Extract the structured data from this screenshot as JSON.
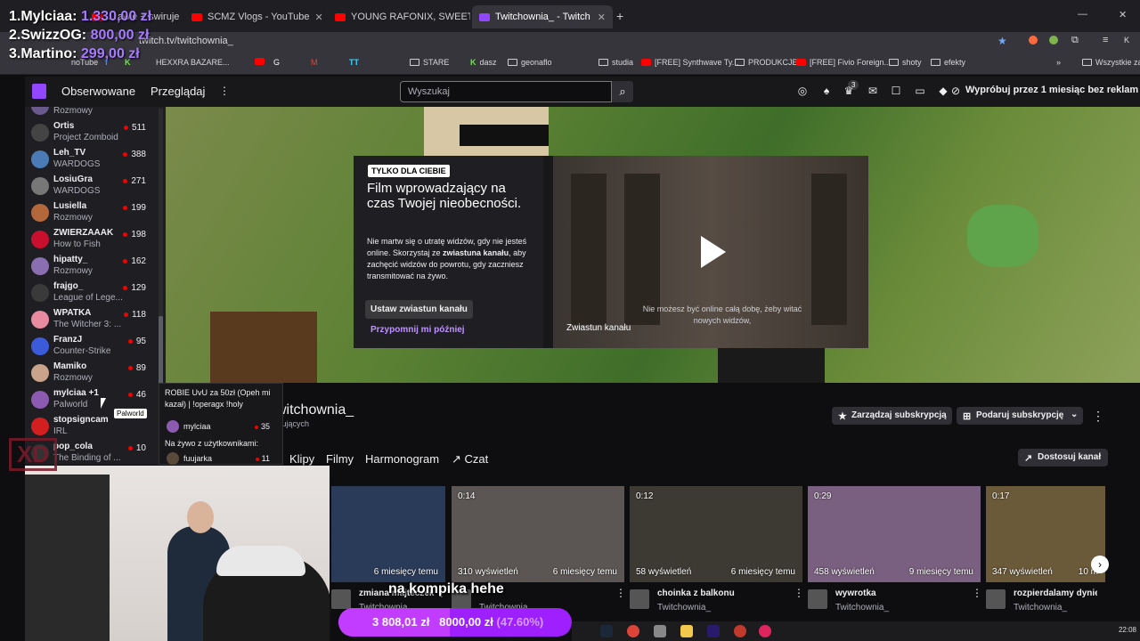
{
  "overlay": {
    "leaderboard": [
      {
        "rank_name": "1.Mylciaa:",
        "amount": "1.330,00 zł"
      },
      {
        "rank_name": "2.SwizzOG:",
        "amount": "800,00 zł"
      },
      {
        "rank_name": "3.Martino:",
        "amount": "299,00 zł"
      }
    ],
    "subtitle": "na kompika hehe",
    "donation": {
      "current": "3 808,01 zł",
      "goal": "8000,00 zł",
      "percent_label": "(47.60%)",
      "progress": 0.476
    }
  },
  "browser": {
    "tabs": [
      {
        "label": "…awie + swiruje pavlaz…",
        "active": false
      },
      {
        "label": "SCMZ Vlogs - YouTube",
        "active": false
      },
      {
        "label": "YOUNG RAFONIX, SWEET A…",
        "active": false
      },
      {
        "label": "Twitchownia_ - Twitch",
        "active": true
      }
    ],
    "url": "twitch.tv/twitchownia_",
    "bookmarks": [
      "noTube",
      "HEXXRA BAZARE...",
      "STARE",
      "dasz",
      "geonaflo",
      "studia",
      "[FREE] Synthwave Ty...",
      "PRODUKCJE",
      "[FREE] Fivio Foreign...",
      "shoty",
      "efekty",
      "Wszystkie zakładki"
    ]
  },
  "twitch": {
    "nav": {
      "following": "Obserwowane",
      "browse": "Przeglądaj",
      "search_placeholder": "Wyszukaj",
      "notif_count": "3",
      "promo": "Wypróbuj przez 1 miesiąc bez reklam"
    },
    "sidebar": [
      {
        "name": "",
        "category": "Rozmowy",
        "viewers": "",
        "color": "#6a5a8c"
      },
      {
        "name": "Ortis",
        "category": "Project Zomboid",
        "viewers": "511",
        "color": "#444"
      },
      {
        "name": "Leh_TV",
        "category": "WARDOGS",
        "viewers": "388",
        "color": "#4a7bb5"
      },
      {
        "name": "LosiuGra",
        "category": "WARDOGS",
        "viewers": "271",
        "color": "#777"
      },
      {
        "name": "Lusiella",
        "category": "Rozmowy",
        "viewers": "199",
        "color": "#b5673c"
      },
      {
        "name": "ZWIERZAAAK",
        "category": "How to Fish",
        "viewers": "198",
        "color": "#c8102e"
      },
      {
        "name": "hipatty_",
        "category": "Rozmowy",
        "viewers": "162",
        "color": "#8a6fb0"
      },
      {
        "name": "frajgo_",
        "category": "League of Lege...",
        "viewers": "129",
        "color": "#3a3a3a"
      },
      {
        "name": "WPATKA",
        "category": "The Witcher 3: ...",
        "viewers": "118",
        "color": "#e88aa0"
      },
      {
        "name": "FranzJ",
        "category": "Counter-Strike",
        "viewers": "95",
        "color": "#3b5bdb"
      },
      {
        "name": "Mamiko",
        "category": "Rozmowy",
        "viewers": "89",
        "color": "#c9a48a"
      },
      {
        "name": "mylciaa +1",
        "category": "Palworld",
        "viewers": "46",
        "color": "#8c5ab0"
      },
      {
        "name": "stopsigncam",
        "category": "IRL",
        "viewers": "",
        "color": "#d31f1f"
      },
      {
        "name": "pop_cola",
        "category": "The Binding of ...",
        "viewers": "10",
        "color": "#333"
      }
    ],
    "tooltip": "Palworld",
    "hovercard": {
      "title": "ROBIE UvU za 50zł (Opeh mi kazał) | !operagx !holy",
      "host": "mylciaa",
      "host_viewers": "35",
      "live_with": "Na żywo z użytkownikami:",
      "guest": "fuujarka",
      "guest_viewers": "11"
    },
    "trailer": {
      "tag": "TYLKO DLA CIEBIE",
      "heading": "Film wprowadzający na czas Twojej nieobecności.",
      "body_1": "Nie martw się o utratę widzów, gdy nie jesteś online. Skorzystaj ze ",
      "body_bold": "zwiastuna kanału",
      "body_2": ", aby zachęcić widzów do powrotu, gdy zaczniesz transmitować na żywo.",
      "set_button": "Ustaw zwiastun kanału",
      "remind_link": "Przypomnij mi później",
      "video_caption": "Zwiastun kanału",
      "video_subtitle": "Nie możesz być online całą dobę, żeby witać nowych widzów,"
    },
    "channel": {
      "name": "witchownia_",
      "followers_fragment": "wujących",
      "manage_sub": "Zarządzaj subskrypcją",
      "gift_sub": "Podaruj subskrypcję",
      "customize": "Dostosuj kanał",
      "tabs": [
        "Klipy",
        "Filmy",
        "Harmonogram",
        "Czat"
      ]
    },
    "clips": [
      {
        "duration": "",
        "views": "",
        "age": "6 miesięcy temu",
        "title": "zmiana majteczek",
        "channel": "Twitchownia_",
        "color": "#2a3b5a"
      },
      {
        "duration": "0:14",
        "views": "310 wyświetleń",
        "age": "6 miesięcy temu",
        "title": "",
        "channel": "Twitchownia_",
        "color": "#5b5654"
      },
      {
        "duration": "0:12",
        "views": "58 wyświetleń",
        "age": "6 miesięcy temu",
        "title": "choinka z balkonu",
        "channel": "Twitchownia_",
        "color": "#3d3a33"
      },
      {
        "duration": "0:29",
        "views": "458 wyświetleń",
        "age": "9 miesięcy temu",
        "title": "wywrotka",
        "channel": "Twitchownia_",
        "color": "#7a6080"
      },
      {
        "duration": "0:17",
        "views": "347 wyświetleń",
        "age": "10 m",
        "title": "rozpierdalamy dynie pe",
        "channel": "Twitchownia_",
        "color": "#6b5a3a"
      }
    ]
  },
  "taskbar": {
    "time": "22:08"
  }
}
